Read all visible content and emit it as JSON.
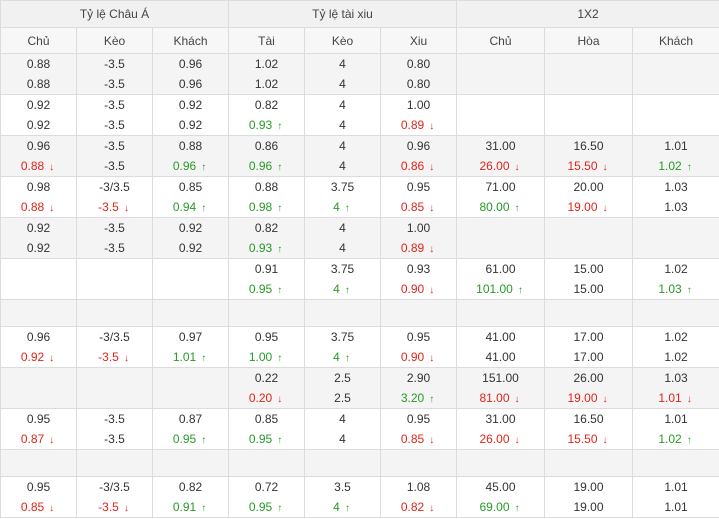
{
  "headers": {
    "groups": [
      "Tỷ lệ Châu Á",
      "Tỷ lệ tài xiu",
      "1X2"
    ],
    "columns": [
      "Chủ",
      "Kèo",
      "Khách",
      "Tài",
      "Kèo",
      "Xiu",
      "Chủ",
      "Hòa",
      "Khách"
    ]
  },
  "colors": {
    "up": "#269b26",
    "down": "#e2241a",
    "header_bg": "#f1f1f1",
    "alt_row_bg": "#f4f4f4"
  },
  "rows": [
    {
      "empty": false,
      "cells": [
        [
          {
            "v": "0.88"
          },
          {
            "v": "0.88"
          }
        ],
        [
          {
            "v": "-3.5"
          },
          {
            "v": "-3.5"
          }
        ],
        [
          {
            "v": "0.96"
          },
          {
            "v": "0.96"
          }
        ],
        [
          {
            "v": "1.02"
          },
          {
            "v": "1.02"
          }
        ],
        [
          {
            "v": "4"
          },
          {
            "v": "4"
          }
        ],
        [
          {
            "v": "0.80"
          },
          {
            "v": "0.80"
          }
        ],
        [],
        [],
        []
      ]
    },
    {
      "empty": false,
      "cells": [
        [
          {
            "v": "0.92"
          },
          {
            "v": "0.92"
          }
        ],
        [
          {
            "v": "-3.5"
          },
          {
            "v": "-3.5"
          }
        ],
        [
          {
            "v": "0.92"
          },
          {
            "v": "0.92"
          }
        ],
        [
          {
            "v": "0.82"
          },
          {
            "v": "0.93",
            "c": "green",
            "a": "up"
          }
        ],
        [
          {
            "v": "4"
          },
          {
            "v": "4"
          }
        ],
        [
          {
            "v": "1.00"
          },
          {
            "v": "0.89",
            "c": "red",
            "a": "down"
          }
        ],
        [],
        [],
        []
      ]
    },
    {
      "empty": false,
      "cells": [
        [
          {
            "v": "0.96"
          },
          {
            "v": "0.88",
            "c": "red",
            "a": "down"
          }
        ],
        [
          {
            "v": "-3.5"
          },
          {
            "v": "-3.5"
          }
        ],
        [
          {
            "v": "0.88"
          },
          {
            "v": "0.96",
            "c": "green",
            "a": "up"
          }
        ],
        [
          {
            "v": "0.86"
          },
          {
            "v": "0.96",
            "c": "green",
            "a": "up"
          }
        ],
        [
          {
            "v": "4"
          },
          {
            "v": "4"
          }
        ],
        [
          {
            "v": "0.96"
          },
          {
            "v": "0.86",
            "c": "red",
            "a": "down"
          }
        ],
        [
          {
            "v": "31.00"
          },
          {
            "v": "26.00",
            "c": "red",
            "a": "down"
          }
        ],
        [
          {
            "v": "16.50"
          },
          {
            "v": "15.50",
            "c": "red",
            "a": "down"
          }
        ],
        [
          {
            "v": "1.01"
          },
          {
            "v": "1.02",
            "c": "green",
            "a": "up"
          }
        ]
      ]
    },
    {
      "empty": false,
      "cells": [
        [
          {
            "v": "0.98"
          },
          {
            "v": "0.88",
            "c": "red",
            "a": "down"
          }
        ],
        [
          {
            "v": "-3/3.5"
          },
          {
            "v": "-3.5",
            "c": "red",
            "a": "down"
          }
        ],
        [
          {
            "v": "0.85"
          },
          {
            "v": "0.94",
            "c": "green",
            "a": "up"
          }
        ],
        [
          {
            "v": "0.88"
          },
          {
            "v": "0.98",
            "c": "green",
            "a": "up"
          }
        ],
        [
          {
            "v": "3.75"
          },
          {
            "v": "4",
            "c": "green",
            "a": "up"
          }
        ],
        [
          {
            "v": "0.95"
          },
          {
            "v": "0.85",
            "c": "red",
            "a": "down"
          }
        ],
        [
          {
            "v": "71.00"
          },
          {
            "v": "80.00",
            "c": "green",
            "a": "up"
          }
        ],
        [
          {
            "v": "20.00"
          },
          {
            "v": "19.00",
            "c": "red",
            "a": "down"
          }
        ],
        [
          {
            "v": "1.03"
          },
          {
            "v": "1.03"
          }
        ]
      ]
    },
    {
      "empty": false,
      "cells": [
        [
          {
            "v": "0.92"
          },
          {
            "v": "0.92"
          }
        ],
        [
          {
            "v": "-3.5"
          },
          {
            "v": "-3.5"
          }
        ],
        [
          {
            "v": "0.92"
          },
          {
            "v": "0.92"
          }
        ],
        [
          {
            "v": "0.82"
          },
          {
            "v": "0.93",
            "c": "green",
            "a": "up"
          }
        ],
        [
          {
            "v": "4"
          },
          {
            "v": "4"
          }
        ],
        [
          {
            "v": "1.00"
          },
          {
            "v": "0.89",
            "c": "red",
            "a": "down"
          }
        ],
        [],
        [],
        []
      ]
    },
    {
      "empty": false,
      "cells": [
        [],
        [],
        [],
        [
          {
            "v": "0.91"
          },
          {
            "v": "0.95",
            "c": "green",
            "a": "up"
          }
        ],
        [
          {
            "v": "3.75"
          },
          {
            "v": "4",
            "c": "green",
            "a": "up"
          }
        ],
        [
          {
            "v": "0.93"
          },
          {
            "v": "0.90",
            "c": "red",
            "a": "down"
          }
        ],
        [
          {
            "v": "61.00"
          },
          {
            "v": "101.00",
            "c": "green",
            "a": "up"
          }
        ],
        [
          {
            "v": "15.00"
          },
          {
            "v": "15.00"
          }
        ],
        [
          {
            "v": "1.02"
          },
          {
            "v": "1.03",
            "c": "green",
            "a": "up"
          }
        ]
      ]
    },
    {
      "empty": true,
      "cells": [
        [],
        [],
        [],
        [],
        [],
        [],
        [],
        [],
        []
      ]
    },
    {
      "empty": false,
      "cells": [
        [
          {
            "v": "0.96"
          },
          {
            "v": "0.92",
            "c": "red",
            "a": "down"
          }
        ],
        [
          {
            "v": "-3/3.5"
          },
          {
            "v": "-3.5",
            "c": "red",
            "a": "down"
          }
        ],
        [
          {
            "v": "0.97"
          },
          {
            "v": "1.01",
            "c": "green",
            "a": "up"
          }
        ],
        [
          {
            "v": "0.95"
          },
          {
            "v": "1.00",
            "c": "green",
            "a": "up"
          }
        ],
        [
          {
            "v": "3.75"
          },
          {
            "v": "4",
            "c": "green",
            "a": "up"
          }
        ],
        [
          {
            "v": "0.95"
          },
          {
            "v": "0.90",
            "c": "red",
            "a": "down"
          }
        ],
        [
          {
            "v": "41.00"
          },
          {
            "v": "41.00"
          }
        ],
        [
          {
            "v": "17.00"
          },
          {
            "v": "17.00"
          }
        ],
        [
          {
            "v": "1.02"
          },
          {
            "v": "1.02"
          }
        ]
      ]
    },
    {
      "empty": false,
      "cells": [
        [],
        [],
        [],
        [
          {
            "v": "0.22"
          },
          {
            "v": "0.20",
            "c": "red",
            "a": "down"
          }
        ],
        [
          {
            "v": "2.5"
          },
          {
            "v": "2.5"
          }
        ],
        [
          {
            "v": "2.90"
          },
          {
            "v": "3.20",
            "c": "green",
            "a": "up"
          }
        ],
        [
          {
            "v": "151.00"
          },
          {
            "v": "81.00",
            "c": "red",
            "a": "down"
          }
        ],
        [
          {
            "v": "26.00"
          },
          {
            "v": "19.00",
            "c": "red",
            "a": "down"
          }
        ],
        [
          {
            "v": "1.03"
          },
          {
            "v": "1.01",
            "c": "red",
            "a": "down"
          }
        ]
      ]
    },
    {
      "empty": false,
      "cells": [
        [
          {
            "v": "0.95"
          },
          {
            "v": "0.87",
            "c": "red",
            "a": "down"
          }
        ],
        [
          {
            "v": "-3.5"
          },
          {
            "v": "-3.5"
          }
        ],
        [
          {
            "v": "0.87"
          },
          {
            "v": "0.95",
            "c": "green",
            "a": "up"
          }
        ],
        [
          {
            "v": "0.85"
          },
          {
            "v": "0.95",
            "c": "green",
            "a": "up"
          }
        ],
        [
          {
            "v": "4"
          },
          {
            "v": "4"
          }
        ],
        [
          {
            "v": "0.95"
          },
          {
            "v": "0.85",
            "c": "red",
            "a": "down"
          }
        ],
        [
          {
            "v": "31.00"
          },
          {
            "v": "26.00",
            "c": "red",
            "a": "down"
          }
        ],
        [
          {
            "v": "16.50"
          },
          {
            "v": "15.50",
            "c": "red",
            "a": "down"
          }
        ],
        [
          {
            "v": "1.01"
          },
          {
            "v": "1.02",
            "c": "green",
            "a": "up"
          }
        ]
      ]
    },
    {
      "empty": true,
      "cells": [
        [],
        [],
        [],
        [],
        [],
        [],
        [],
        [],
        []
      ]
    },
    {
      "empty": false,
      "cells": [
        [
          {
            "v": "0.95"
          },
          {
            "v": "0.85",
            "c": "red",
            "a": "down"
          }
        ],
        [
          {
            "v": "-3/3.5"
          },
          {
            "v": "-3.5",
            "c": "red",
            "a": "down"
          }
        ],
        [
          {
            "v": "0.82"
          },
          {
            "v": "0.91",
            "c": "green",
            "a": "up"
          }
        ],
        [
          {
            "v": "0.72"
          },
          {
            "v": "0.95",
            "c": "green",
            "a": "up"
          }
        ],
        [
          {
            "v": "3.5"
          },
          {
            "v": "4",
            "c": "green",
            "a": "up"
          }
        ],
        [
          {
            "v": "1.08"
          },
          {
            "v": "0.82",
            "c": "red",
            "a": "down"
          }
        ],
        [
          {
            "v": "45.00"
          },
          {
            "v": "69.00",
            "c": "green",
            "a": "up"
          }
        ],
        [
          {
            "v": "19.00"
          },
          {
            "v": "19.00"
          }
        ],
        [
          {
            "v": "1.01"
          },
          {
            "v": "1.01"
          }
        ]
      ]
    }
  ]
}
